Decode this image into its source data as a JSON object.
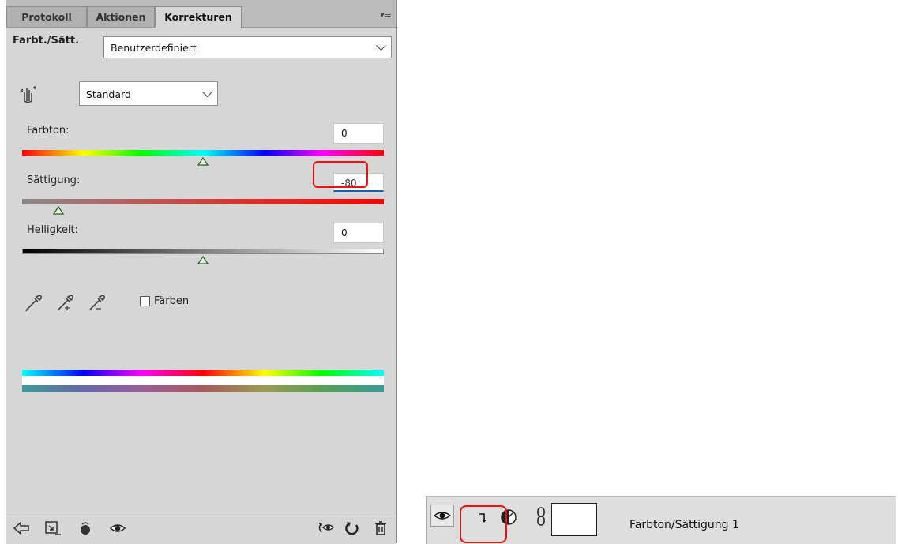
{
  "tabs": [
    {
      "label": "Protokoll"
    },
    {
      "label": "Aktionen"
    },
    {
      "label": "Korrekturen"
    }
  ],
  "header": {
    "title": "Farbt./Sätt.",
    "preset_value": "Benutzerdefiniert"
  },
  "range_select": {
    "value": "Standard"
  },
  "sliders": {
    "hue": {
      "label": "Farbton:",
      "value": "0",
      "position": 0.5
    },
    "saturation": {
      "label": "Sättigung:",
      "value": "-80",
      "position": 0.1
    },
    "lightness": {
      "label": "Helligkeit:",
      "value": "0",
      "position": 0.5
    }
  },
  "colorize": {
    "label": "Färben",
    "checked": false
  },
  "layer": {
    "name": "Farbton/Sättigung 1"
  },
  "colors": {
    "highlight": "#e11111",
    "panel": "#d6d6d6"
  },
  "icons": [
    "hand-target-icon",
    "eyedropper-icon",
    "eyedropper-plus-icon",
    "eyedropper-minus-icon",
    "back-arrow-icon",
    "clip-layer-icon",
    "view-previous-icon",
    "eye-icon",
    "reset-icon",
    "delete-icon",
    "chain-link-icon",
    "adjustment-icon",
    "clip-arrow-icon"
  ]
}
